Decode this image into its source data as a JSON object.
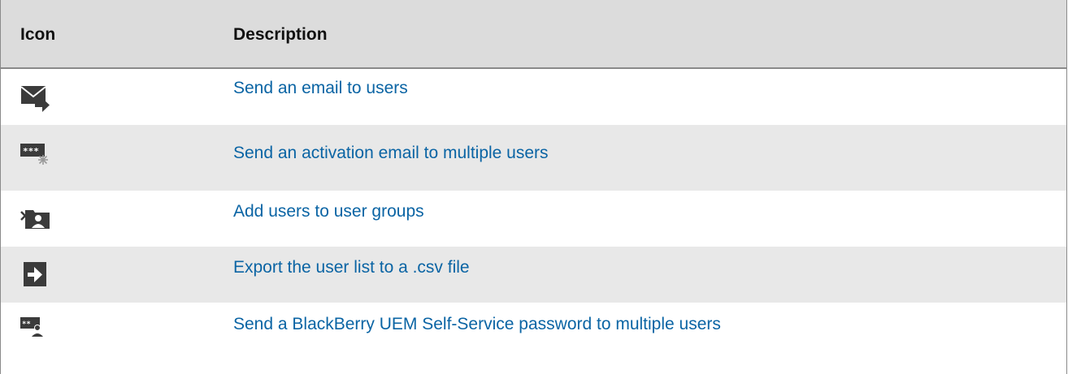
{
  "table": {
    "headers": {
      "icon": "Icon",
      "description": "Description"
    },
    "rows": [
      {
        "icon": "email-send-icon",
        "description": "Send an email to users"
      },
      {
        "icon": "activation-email-icon",
        "description": "Send an activation email to multiple users"
      },
      {
        "icon": "add-to-group-icon",
        "description": "Add users to user groups"
      },
      {
        "icon": "export-icon",
        "description": "Export the user list to a .csv file"
      },
      {
        "icon": "self-service-password-icon",
        "description": "Send a BlackBerry UEM Self-Service password to multiple users"
      }
    ]
  },
  "colors": {
    "link": "#0a64a4",
    "header_bg": "#dcdcdc",
    "alt_row_bg": "#e8e8e8",
    "icon_fill": "#3b3b3b"
  }
}
